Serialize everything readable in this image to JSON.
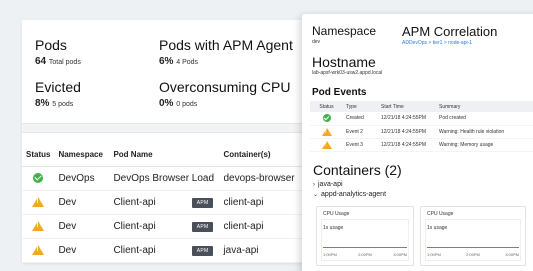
{
  "summary": {
    "pods_label": "Pods",
    "pods_value": "64",
    "pods_sub": "Total pods",
    "apm_label": "Pods with APM Agent",
    "apm_value": "6%",
    "apm_sub": "4 Pods",
    "evicted_label": "Evicted",
    "evicted_value": "8%",
    "evicted_sub": "5 pods",
    "overconsuming_label": "Overconsuming CPU",
    "overconsuming_value": "0%",
    "overconsuming_sub": "0 pods"
  },
  "pods_table": {
    "headers": [
      "Status",
      "Namespace",
      "Pod Name",
      "Container(s)"
    ],
    "rows": [
      {
        "status": "ok",
        "namespace": "DevOps",
        "pod": "DevOps Browser Load",
        "apm": "",
        "container": "devops-browser"
      },
      {
        "status": "warning",
        "namespace": "Dev",
        "pod": "Client-api",
        "apm": "APM",
        "container": "client-api"
      },
      {
        "status": "warning",
        "namespace": "Dev",
        "pod": "Client-api",
        "apm": "APM",
        "container": "client-api"
      },
      {
        "status": "warning",
        "namespace": "Dev",
        "pod": "Client-api",
        "apm": "APM",
        "container": "java-api"
      }
    ]
  },
  "detail": {
    "namespace_label": "Namespace",
    "namespace_value": "dev",
    "apm_label": "APM Correlation",
    "apm_link": "ADDevOps > tier1 > node-api-1",
    "hostname_label": "Hostname",
    "hostname_value": "lab-apsf-wrk03-usw2.appd.local",
    "events_title": "Pod Events",
    "events_headers": [
      "Status",
      "Type",
      "Start Time",
      "Summary"
    ],
    "events": [
      {
        "status": "ok",
        "type": "Created",
        "time": "12/21/18 4:24:55PM",
        "summary": "Pod created"
      },
      {
        "status": "warning",
        "type": "Event 2",
        "time": "12/21/18 4:24:55PM",
        "summary": "Warning: Health rule violation"
      },
      {
        "status": "warning",
        "type": "Event 3",
        "time": "12/21/18 4:24:55PM",
        "summary": "Warning: Memory usage"
      }
    ],
    "containers_title": "Containers (2)",
    "containers": [
      {
        "chevron": "›",
        "name": "java-api"
      },
      {
        "chevron": "⌄",
        "name": "appd-analytics-agent"
      }
    ],
    "cards": [
      {
        "title": "CPU Usage",
        "value": "1x usage",
        "ticks": [
          "1:00PM",
          "2:00PM",
          "3:00PM"
        ]
      },
      {
        "title": "CPU Usage",
        "value": "1x usage",
        "ticks": [
          "1:00PM",
          "2:00PM",
          "3:00PM"
        ]
      }
    ]
  },
  "colors": {
    "ok": "#46b04a",
    "warning": "#f5a623",
    "link": "#2a7bd8",
    "chart_line": "#7b6cd9"
  }
}
